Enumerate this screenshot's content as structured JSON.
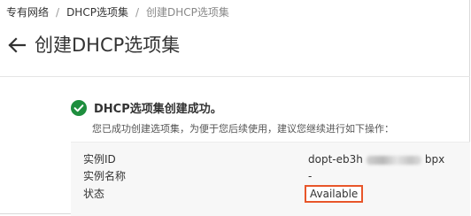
{
  "breadcrumb": {
    "items": [
      "专有网络",
      "DHCP选项集",
      "创建DHCP选项集"
    ],
    "separator": "/"
  },
  "header": {
    "title": "创建DHCP选项集",
    "back_icon": "arrow-left-icon"
  },
  "result": {
    "icon": "check-circle-icon",
    "icon_color": "#1e8e3e",
    "title": "DHCP选项集创建成功。",
    "description": "您已成功创建选项集，为便于您后续使用，建议您继续进行如下操作："
  },
  "details": {
    "instance_id_label": "实例ID",
    "instance_id_prefix": "dopt-eb3h",
    "instance_id_suffix": "bpx",
    "instance_name_label": "实例名称",
    "instance_name_value": "-",
    "status_label": "状态",
    "status_value": "Available",
    "status_highlight_color": "#e8562a"
  }
}
